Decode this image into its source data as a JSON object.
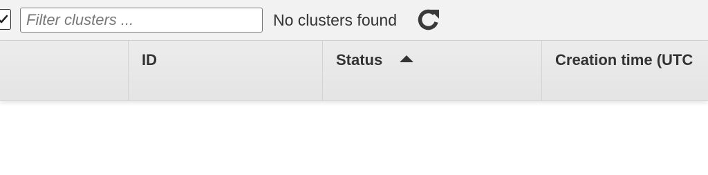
{
  "toolbar": {
    "filter": {
      "placeholder": "Filter clusters ...",
      "value": ""
    },
    "status_text": "No clusters found",
    "refresh_icon": "refresh-icon",
    "select_all_checked": true
  },
  "table": {
    "columns": [
      {
        "label": ""
      },
      {
        "label": "ID"
      },
      {
        "label": "Status",
        "sort": "ascending",
        "sort_icon": "sort-ascending-icon"
      },
      {
        "label": "Creation time (UTC"
      }
    ]
  },
  "colors": {
    "toolbar_bg": "#f2f2f2",
    "header_bg": "#e8e8e8",
    "text": "#333333"
  }
}
